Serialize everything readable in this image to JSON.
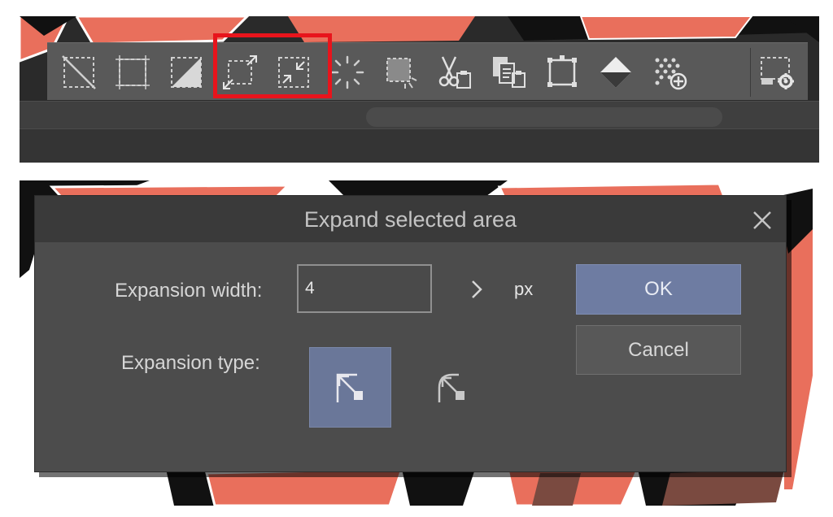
{
  "toolbar": {
    "tools": [
      {
        "icon": "deselect-icon"
      },
      {
        "icon": "select-all-icon"
      },
      {
        "icon": "invert-selection-icon"
      },
      {
        "icon": "expand-selection-icon"
      },
      {
        "icon": "shrink-selection-icon"
      },
      {
        "icon": "selection-boundary-icon"
      },
      {
        "icon": "selection-fill-icon"
      },
      {
        "icon": "cut-paste-icon"
      },
      {
        "icon": "copy-paste-icon"
      },
      {
        "icon": "transform-selection-icon"
      },
      {
        "icon": "fill-bucket-icon"
      },
      {
        "icon": "add-screentone-icon"
      },
      {
        "icon": "selection-settings-icon"
      }
    ],
    "highlighted_tools": [
      "expand-selection-icon",
      "shrink-selection-icon"
    ],
    "highlight_color": "#e8141c"
  },
  "dialog": {
    "title": "Expand selected area",
    "close_icon": "close-icon",
    "expansion_width_label": "Expansion width:",
    "expansion_width_value": "4",
    "spinner_icon": "chevron-right-icon",
    "unit": "px",
    "expansion_type_label": "Expansion type:",
    "expansion_types": [
      {
        "icon": "sharp-corner-icon",
        "selected": true
      },
      {
        "icon": "round-corner-icon",
        "selected": false
      }
    ],
    "ok_label": "OK",
    "cancel_label": "Cancel"
  },
  "colors": {
    "ui_dark": "#3a3a3a",
    "dialog_body": "#4c4c4c",
    "ok_button": "#6e7ca2",
    "selected_type": "#6a7799",
    "artwork_fill": "#e96f5c",
    "artwork_line": "#111111"
  }
}
